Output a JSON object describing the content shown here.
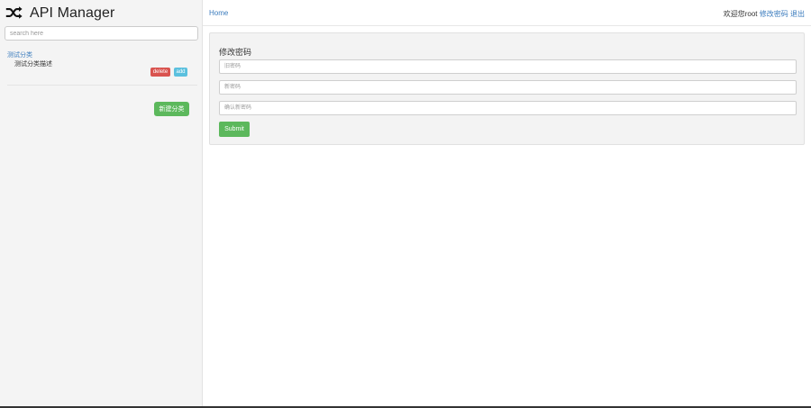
{
  "app": {
    "title": "API Manager",
    "logo_icon": "shuffle-icon"
  },
  "sidebar": {
    "search_placeholder": "search here",
    "categories": [
      {
        "name": "测试分类",
        "description": "测试分类描述",
        "delete_label": "delete",
        "add_label": "add"
      }
    ],
    "new_category_label": "新建分类"
  },
  "nav": {
    "home_label": "Home",
    "welcome_text": "欢迎您root",
    "change_password_link": "修改密码",
    "logout_link": "退出"
  },
  "form": {
    "title": "修改密码",
    "old_password_placeholder": "旧密码",
    "new_password_placeholder": "新密码",
    "confirm_password_placeholder": "确认新密码",
    "submit_label": "Submit"
  },
  "colors": {
    "link": "#3a7bbd",
    "danger": "#d9534f",
    "info": "#5bc0de",
    "success": "#5cb85c"
  }
}
